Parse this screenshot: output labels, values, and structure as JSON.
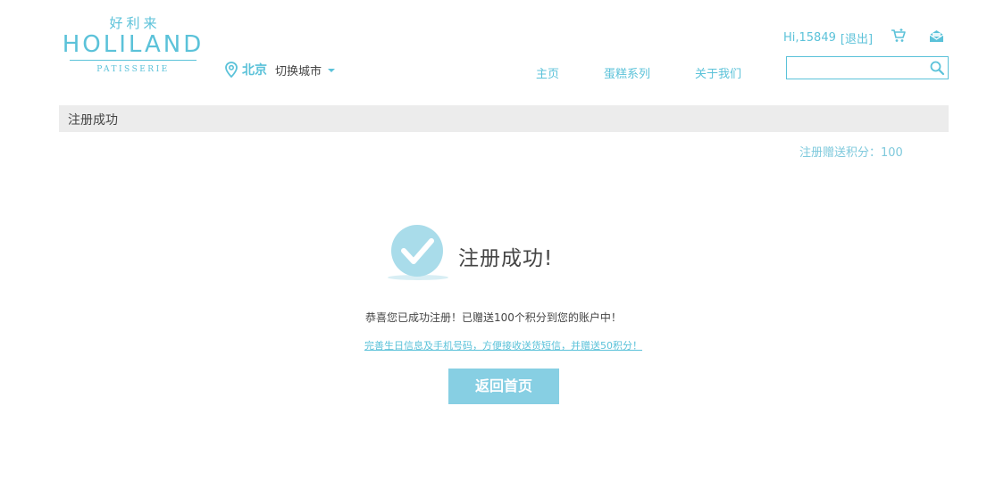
{
  "brand": {
    "cn_name": "好利来",
    "en_name": "HOLILAND",
    "tagline": "PATISSERIE"
  },
  "location": {
    "city": "北京",
    "switch_label": "切换城市"
  },
  "user": {
    "greeting": "Hi,15849",
    "logout_label": "[退出]"
  },
  "nav": {
    "items": [
      {
        "label": "主页"
      },
      {
        "label": "蛋糕系列"
      },
      {
        "label": "关于我们"
      }
    ]
  },
  "search": {
    "value": "",
    "placeholder": ""
  },
  "page": {
    "title_bar": "注册成功",
    "points_note": "注册赠送积分：100",
    "success_title": "注册成功!",
    "congrats": "恭喜您已成功注册！已赠送100个积分到您的账户中！",
    "complete_link": "完善生日信息及手机号码，方便接收送货短信，并赠送50积分！",
    "home_button": "返回首页"
  },
  "colors": {
    "accent": "#5bc2d9",
    "button": "#87cfe3",
    "title_bar_bg": "#ececec"
  },
  "icons": {
    "location": "location-pin-icon",
    "cart": "cart-icon",
    "mail": "mail-icon",
    "search": "search-icon",
    "success": "checkmark-circle-icon"
  }
}
